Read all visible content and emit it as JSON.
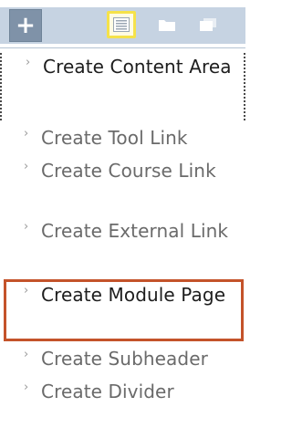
{
  "toolbar": {
    "add_icon": "plus-icon",
    "add_symbol": "+",
    "views": [
      {
        "icon": "list-view-icon",
        "selected": true
      },
      {
        "icon": "folder-view-icon",
        "selected": false
      },
      {
        "icon": "window-view-icon",
        "selected": false
      }
    ]
  },
  "menu": {
    "chevron": "›",
    "items": [
      {
        "label": "Create Content Area",
        "emphasized": true
      },
      {
        "label": "Create Tool Link",
        "emphasized": false
      },
      {
        "label": "Create Course Link",
        "emphasized": false
      },
      {
        "label": "Create External Link",
        "emphasized": false
      },
      {
        "label": "Create Module Page",
        "emphasized": true,
        "highlighted": true
      },
      {
        "label": "Create Subheader",
        "emphasized": false
      },
      {
        "label": "Create Divider",
        "emphasized": false
      }
    ]
  },
  "colors": {
    "toolbar_bg": "#c6d3e2",
    "add_button": "#7f92a8",
    "selected_view_border": "#f5e24a",
    "highlight_border": "#c4532a",
    "text_emphasized": "#1d1d1d",
    "text_normal": "#6a6a6a"
  }
}
